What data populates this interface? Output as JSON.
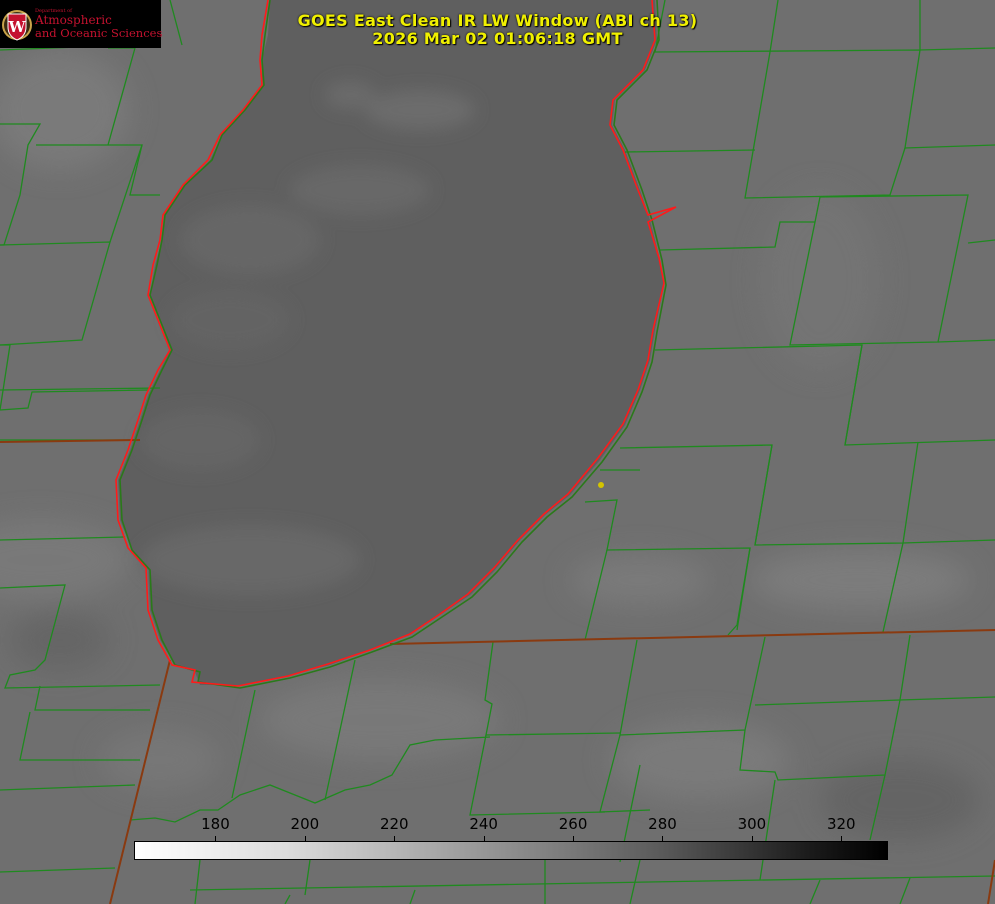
{
  "title": {
    "line1": "GOES East Clean IR LW Window (ABI ch 13)",
    "line2": "2026 Mar 02 01:06:18 GMT"
  },
  "logo": {
    "department": "Department of",
    "line1": "Atmospheric",
    "line2": "and Oceanic Sciences",
    "shield_letter": "W",
    "colors": {
      "text": "#c4122f",
      "background": "#000000",
      "shield": "#c4122f"
    }
  },
  "colorbar": {
    "ticks": [
      "180",
      "200",
      "220",
      "240",
      "260",
      "280",
      "300",
      "320"
    ],
    "range": [
      162,
      330
    ],
    "scale": "white (cold) to black (warm)"
  },
  "colors": {
    "county_lines": "#1f8a1f",
    "state_lines": "#8a3a10",
    "lake_shoreline": "#ff1a1a",
    "title_text": "#f0f000",
    "marker": "#d4c400",
    "land": "#707070",
    "lake": "#5f5f5f"
  }
}
